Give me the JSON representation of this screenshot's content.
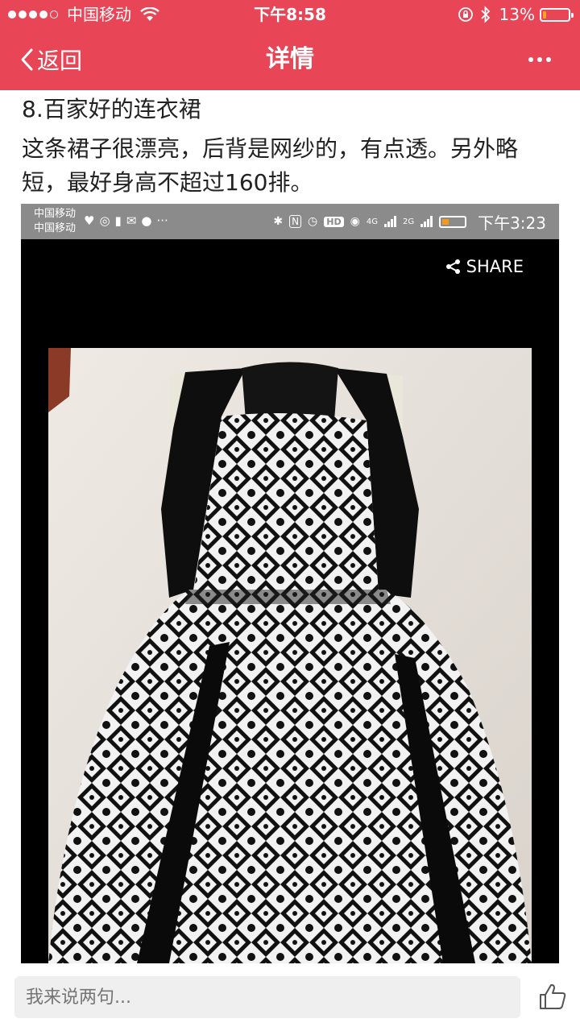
{
  "status_bar": {
    "carrier": "中国移动",
    "time": "下午8:58",
    "battery_text": "13%",
    "battery_level": 0.13,
    "battery_color": "#f5a623"
  },
  "nav": {
    "back_label": "返回",
    "title": "详情",
    "more_icon": "more-icon"
  },
  "post": {
    "title": "8.百家好的连衣裙",
    "body": "这条裙子很漂亮，后背是网纱的，有点透。另外略短，最好身高不超过160排。"
  },
  "embedded_screenshot": {
    "carrier_1": "中国移动",
    "carrier_2": "中国移动",
    "network_4g": "4G",
    "network_2g": "2G",
    "hd_badge": "HD",
    "time": "下午3:23",
    "share_label": "SHARE"
  },
  "comment_bar": {
    "placeholder": "我来说两句..."
  },
  "colors": {
    "brand": "#e84657",
    "status_gray": "#8b8b8b"
  }
}
